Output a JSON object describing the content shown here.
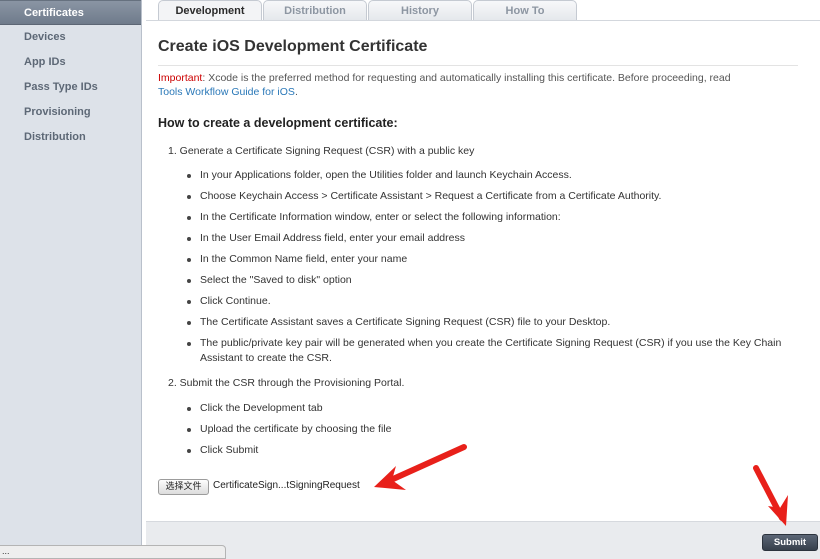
{
  "sidebar": {
    "items": [
      {
        "label": "Certificates"
      },
      {
        "label": "Devices"
      },
      {
        "label": "App IDs"
      },
      {
        "label": "Pass Type IDs"
      },
      {
        "label": "Provisioning"
      },
      {
        "label": "Distribution"
      }
    ],
    "active": "Certificates"
  },
  "tabs": [
    {
      "label": "Development"
    },
    {
      "label": "Distribution"
    },
    {
      "label": "History"
    },
    {
      "label": "How To"
    }
  ],
  "main": {
    "title": "Create iOS Development Certificate",
    "notice": {
      "important_label": "Important",
      "text": ": Xcode is the preferred method for requesting and automatically installing this certificate. Before proceeding, read",
      "link": "Tools Workflow Guide for iOS",
      "end": "."
    },
    "howto_heading": "How to create a development certificate:",
    "step1": {
      "text": "1.  Generate a Certificate Signing Request (CSR) with a public key",
      "bullets": [
        "In your Applications folder, open the Utilities folder and launch Keychain Access.",
        "Choose Keychain Access > Certificate Assistant > Request a Certificate from a Certificate Authority.",
        "In the Certificate Information window, enter or select the following information:",
        "In the User Email Address field, enter your email address",
        "In the Common Name field, enter your name",
        "Select the \"Saved to disk\" option",
        "Click Continue.",
        "The Certificate Assistant saves a Certificate Signing Request (CSR) file to your Desktop.",
        "The public/private key pair will be generated when you create the Certificate Signing Request (CSR) if you use the Key Chain Assistant to create the CSR."
      ]
    },
    "step2": {
      "text": "2.  Submit the CSR through the Provisioning Portal.",
      "bullets": [
        "Click the Development tab",
        "Upload the certificate by choosing the file",
        "Click Submit"
      ]
    },
    "file_chooser": {
      "button_label": "选择文件",
      "file_name": "CertificateSign...tSigningRequest"
    }
  },
  "footer": {
    "submit_label": "Submit"
  },
  "status_bar": {
    "text": "..."
  },
  "colors": {
    "sidebar_bg": "#dde2e9",
    "active_item": "#6f7b8b",
    "important": "#cc0000",
    "link": "#2a78b8",
    "annotation_arrow": "#e8201a",
    "submit_button": "#3d4654"
  },
  "icons": [
    "annotation-arrow-left",
    "annotation-arrow-down"
  ]
}
